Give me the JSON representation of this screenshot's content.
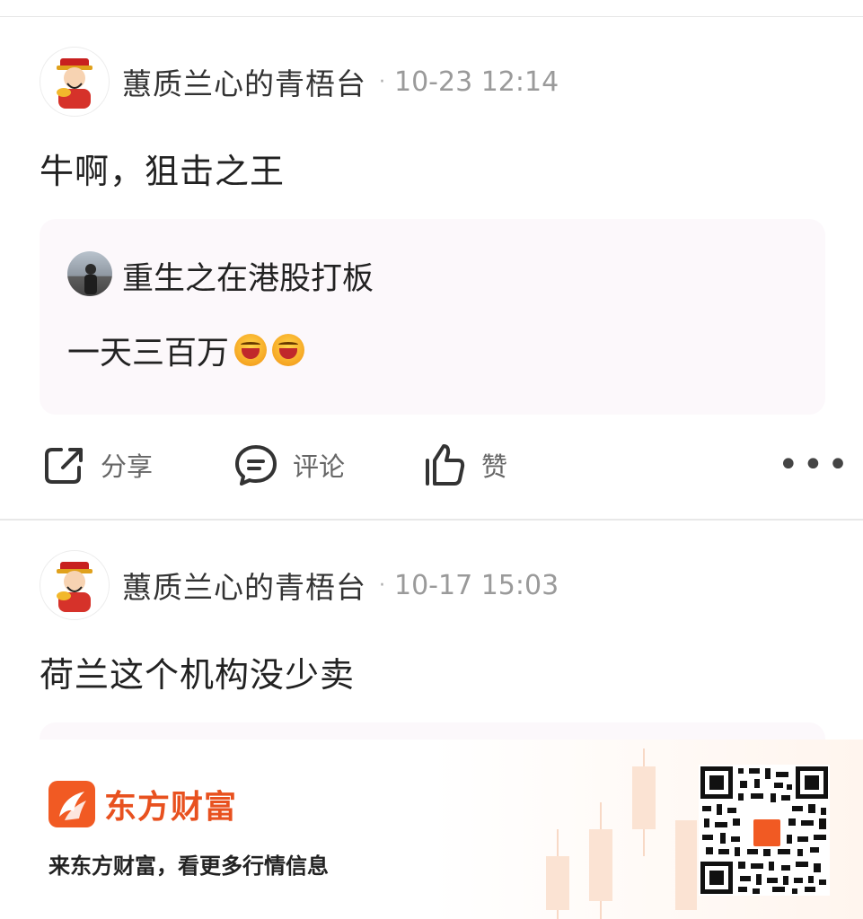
{
  "posts": [
    {
      "author": "蕙质兰心的青梧台",
      "separator": "·",
      "time": "10-23 12:14",
      "text": "牛啊，狙击之王",
      "quote": {
        "author": "重生之在港股打板",
        "text": "一天三百万",
        "emojis": [
          "laughing-emoji",
          "laughing-emoji"
        ]
      },
      "actions": {
        "share_label": "分享",
        "comment_label": "评论",
        "like_label": "赞",
        "more_label": "•••"
      }
    },
    {
      "author": "蕙质兰心的青梧台",
      "separator": "·",
      "time": "10-17 15:03",
      "text": "荷兰这个机构没少卖"
    }
  ],
  "banner": {
    "brand": "东方财富",
    "slogan": "来东方财富，看更多行情信息",
    "brand_color": "#f15a23"
  }
}
